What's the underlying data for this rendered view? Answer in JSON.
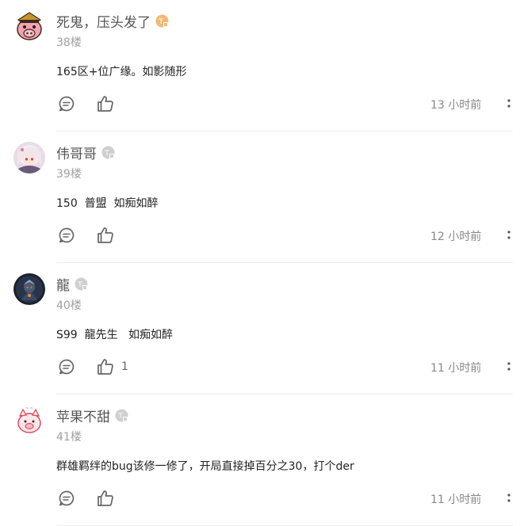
{
  "colors": {
    "badge_orange": "#f1b877",
    "badge_gray": "#cfcfcf",
    "icon_gray": "#666666",
    "divider": "#ececec"
  },
  "comments": [
    {
      "username": "死鬼，压头发了",
      "badge": "T",
      "badge_color": "orange",
      "floor": "38楼",
      "content": "165区+位广缘。如影随形",
      "likes": "",
      "time": "13 小时前",
      "avatar_icon": "pig-avatar"
    },
    {
      "username": "伟哥哥",
      "badge": "T",
      "badge_color": "gray",
      "floor": "39楼",
      "content": "150  普盟  如痴如醉",
      "likes": "",
      "time": "12 小时前",
      "avatar_icon": "anime-girl-avatar"
    },
    {
      "username": "龍",
      "badge": "T",
      "badge_color": "gray",
      "floor": "40楼",
      "content": "S99  龍先生   如痴如醉",
      "likes": "1",
      "time": "11 小时前",
      "avatar_icon": "dark-knight-avatar"
    },
    {
      "username": "苹果不甜",
      "badge": "T",
      "badge_color": "gray",
      "floor": "41楼",
      "content": "群雄羁绊的bug该修一修了，开局直接掉百分之30，打个der",
      "likes": "",
      "time": "11 小时前",
      "avatar_icon": "cartoon-pig-avatar"
    }
  ]
}
